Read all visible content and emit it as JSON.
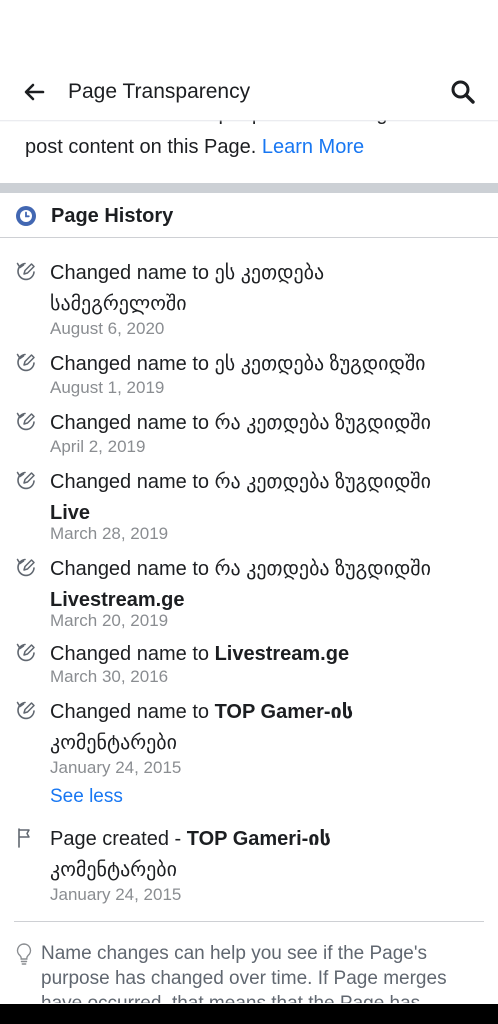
{
  "header": {
    "title": "Page Transparency"
  },
  "intro": {
    "cut_line": "information about the people who manage and",
    "line2": "post content on this Page.",
    "learn_more": "Learn More"
  },
  "history": {
    "title": "Page History",
    "entries": [
      {
        "prefix": "Changed name to ",
        "name_line1": "ეს კეთდება",
        "name_line2": "სამეგრელოში",
        "date": "August 6, 2020"
      },
      {
        "prefix": "Changed name to ",
        "name_line1": "ეს კეთდება ზუგდიდში",
        "date": "August 1, 2019"
      },
      {
        "prefix": "Changed name to ",
        "name_line1": "რა კეთდება ზუგდიდში",
        "date": "April 2, 2019"
      },
      {
        "prefix": "Changed name to ",
        "name_line1": "რა კეთდება ზუგდიდში",
        "name_line2": "Live",
        "date": "March 28, 2019"
      },
      {
        "prefix": "Changed name to ",
        "name_line1": "რა კეთდება ზუგდიდში",
        "name_line2": "Livestream.ge",
        "date": "March 20, 2019"
      },
      {
        "prefix": "Changed name to ",
        "name_line1": "Livestream.ge",
        "date": "March 30, 2016"
      },
      {
        "prefix": "Changed name to ",
        "name_line1": "TOP Gamer-ის",
        "name_line2": "კომენტარები",
        "date": "January 24, 2015"
      }
    ],
    "see_less": "See less",
    "created": {
      "prefix": "Page created - ",
      "name_line1": "TOP Gameri-ის",
      "name_line2": "კომენტარები",
      "date": "January 24, 2015"
    }
  },
  "footer": {
    "note": "Name changes can help you see if the Page's purpose has changed over time. If Page merges have occurred, that means that the Page has"
  },
  "colors": {
    "link": "#1877f2",
    "history_icon": "#4267b2",
    "divider": "#ccd0d5",
    "muted": "#8a8d91"
  },
  "icons": {
    "back": "arrow-left-icon",
    "search": "search-icon",
    "history": "clock-icon",
    "name_change": "edit-cycle-icon",
    "created": "flag-icon",
    "note": "lightbulb-icon"
  }
}
